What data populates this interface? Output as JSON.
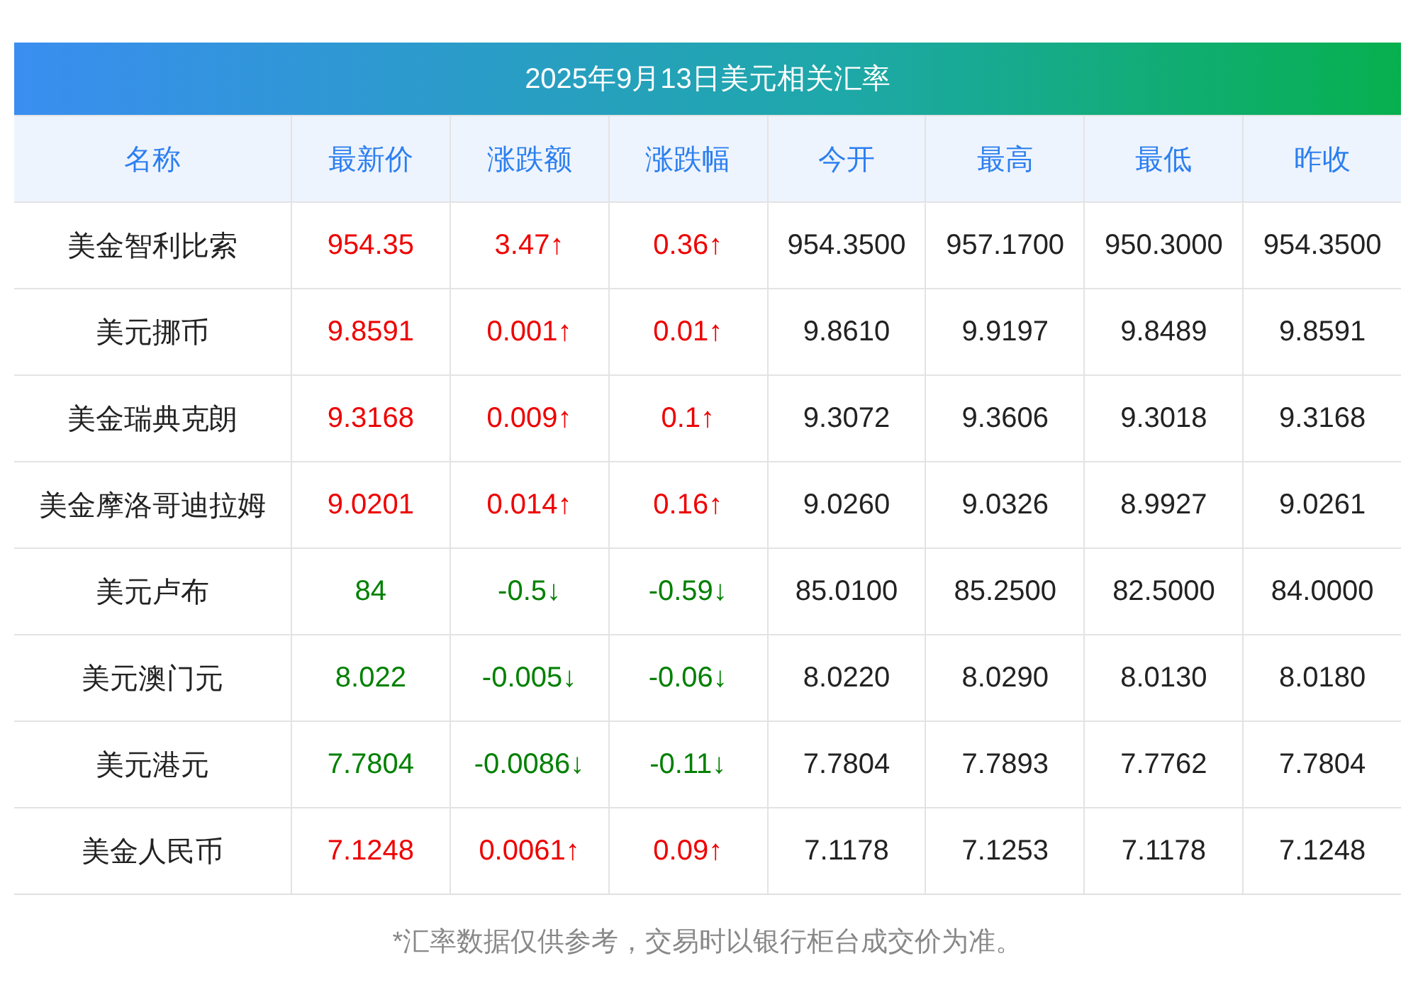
{
  "title": "2025年9月13日美元相关汇率",
  "columns": [
    "名称",
    "最新价",
    "涨跌额",
    "涨跌幅",
    "今开",
    "最高",
    "最低",
    "昨收"
  ],
  "rows": [
    {
      "color": "#ee0000",
      "cells": [
        "美金智利比索",
        "954.35",
        "3.47↑",
        "0.36↑",
        "954.3500",
        "957.1700",
        "950.3000",
        "954.3500"
      ]
    },
    {
      "color": "#ee0000",
      "cells": [
        "美元挪币",
        "9.8591",
        "0.001↑",
        "0.01↑",
        "9.8610",
        "9.9197",
        "9.8489",
        "9.8591"
      ]
    },
    {
      "color": "#ee0000",
      "cells": [
        "美金瑞典克朗",
        "9.3168",
        "0.009↑",
        "0.1↑",
        "9.3072",
        "9.3606",
        "9.3018",
        "9.3168"
      ]
    },
    {
      "color": "#ee0000",
      "cells": [
        "美金摩洛哥迪拉姆",
        "9.0201",
        "0.014↑",
        "0.16↑",
        "9.0260",
        "9.0326",
        "8.9927",
        "9.0261"
      ]
    },
    {
      "color": "#008000",
      "cells": [
        "美元卢布",
        "84",
        "-0.5↓",
        "-0.59↓",
        "85.0100",
        "85.2500",
        "82.5000",
        "84.0000"
      ]
    },
    {
      "color": "#008000",
      "cells": [
        "美元澳门元",
        "8.022",
        "-0.005↓",
        "-0.06↓",
        "8.0220",
        "8.0290",
        "8.0130",
        "8.0180"
      ]
    },
    {
      "color": "#008000",
      "cells": [
        "美元港元",
        "7.7804",
        "-0.0086↓",
        "-0.11↓",
        "7.7804",
        "7.7893",
        "7.7762",
        "7.7804"
      ]
    },
    {
      "color": "#ee0000",
      "cells": [
        "美金人民币",
        "7.1248",
        "0.0061↑",
        "0.09↑",
        "7.1178",
        "7.1253",
        "7.1178",
        "7.1248"
      ]
    }
  ],
  "footnote": "*汇率数据仅供参考，交易时以银行柜台成交价为准。"
}
